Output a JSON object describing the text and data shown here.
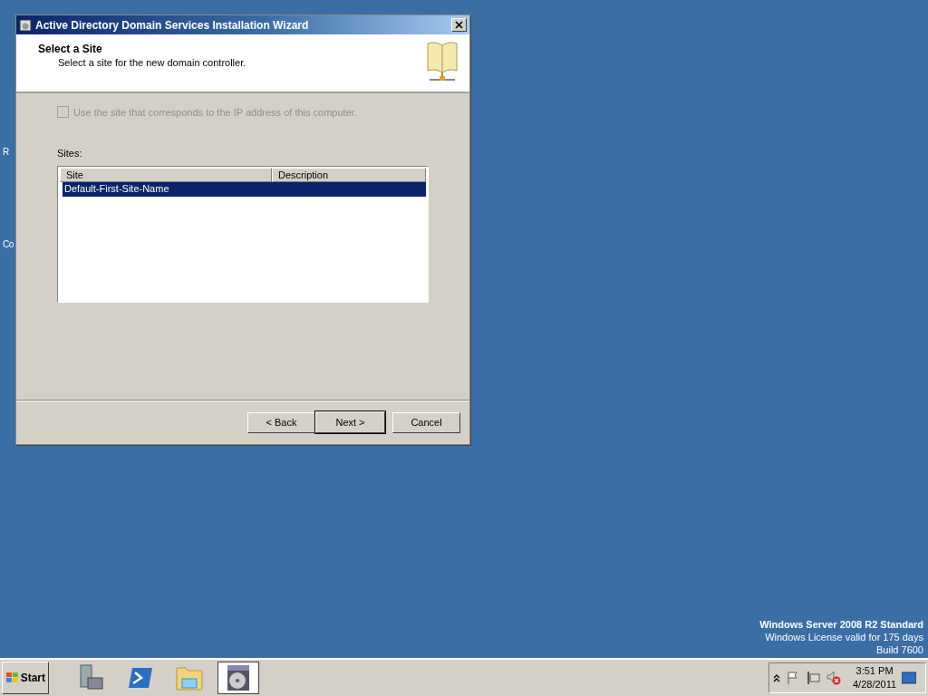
{
  "desktop": {
    "icon_labels": [
      {
        "label": "R"
      },
      {
        "label": "Co"
      }
    ]
  },
  "window": {
    "title": "Active Directory Domain Services Installation Wizard",
    "heading": "Select a Site",
    "subheading": "Select a site for the new domain controller.",
    "checkbox": {
      "label": "Use the site that corresponds to the IP address of this computer.",
      "checked": false,
      "disabled": true
    },
    "sites_label": "Sites:",
    "table": {
      "columns": [
        "Site",
        "Description"
      ],
      "rows": [
        {
          "site": "Default-First-Site-Name",
          "selected": true
        }
      ]
    },
    "buttons": [
      {
        "label": "< Back",
        "default": false
      },
      {
        "label": "Next >",
        "default": true
      },
      {
        "label": "Cancel",
        "default": false
      }
    ]
  },
  "edition_info": {
    "product": "Windows Server 2008 R2 Standard",
    "license": "Windows License valid for  175 days",
    "build": "Build 7600"
  },
  "taskbar": {
    "start": "Start",
    "apps": [
      {
        "kind": "server",
        "selected": false
      },
      {
        "kind": "shell",
        "selected": false
      },
      {
        "kind": "folder",
        "selected": false
      },
      {
        "kind": "wizard",
        "selected": true
      }
    ],
    "time": "3:51 PM",
    "date": "4/28/2011"
  }
}
